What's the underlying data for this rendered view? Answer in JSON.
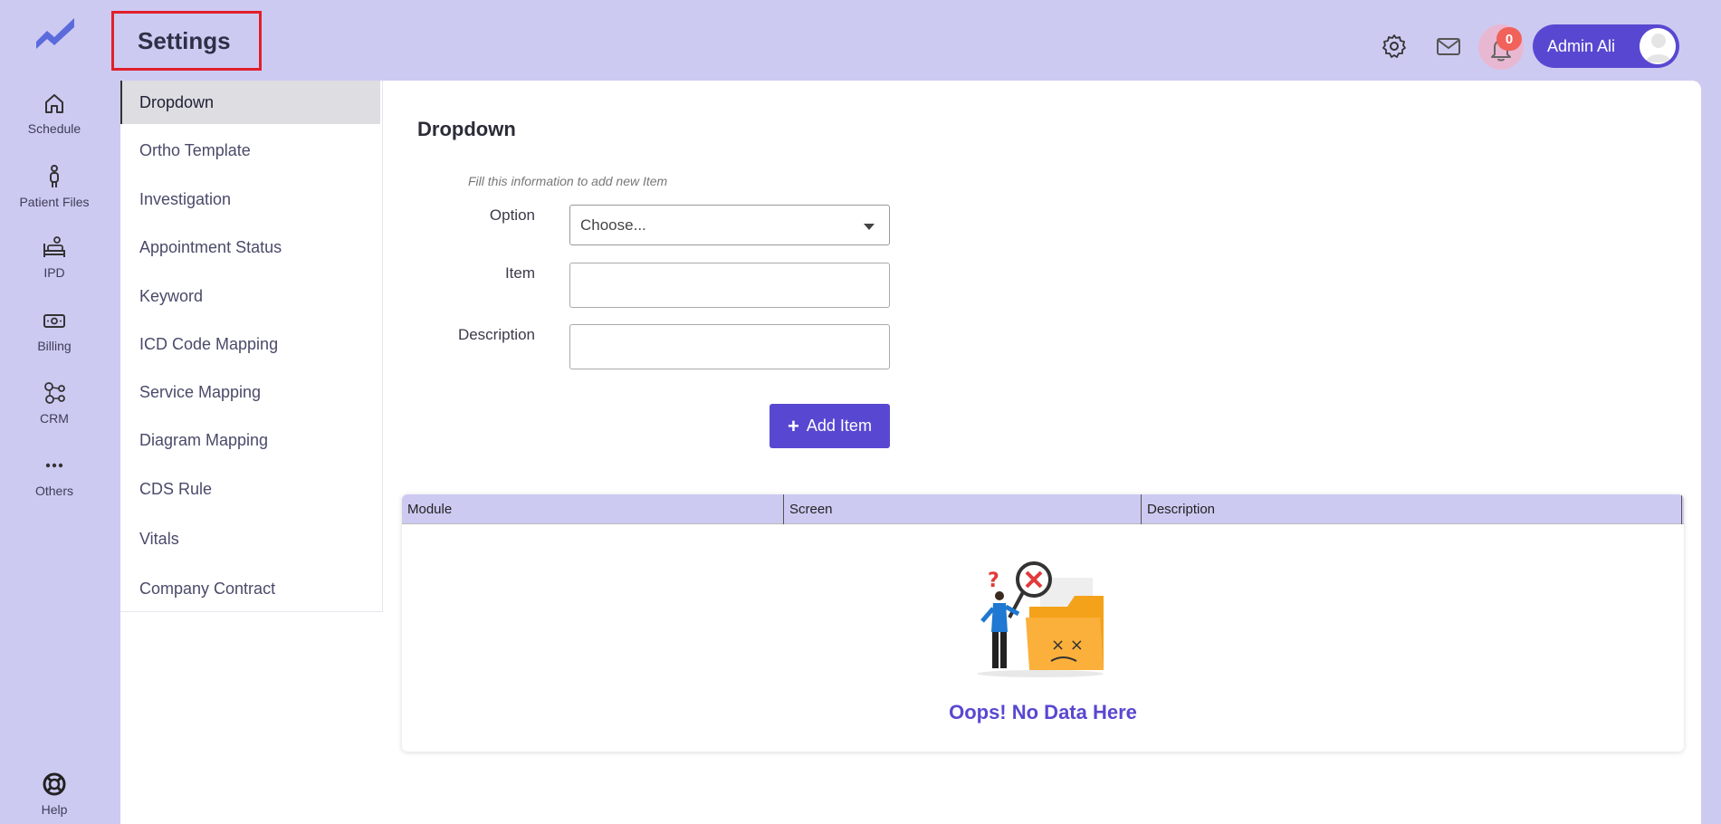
{
  "app": {
    "page_title": "Settings",
    "accent_color": "#5848d1",
    "sidebar_bg": "#cdcaf2"
  },
  "rail": {
    "items": [
      {
        "label": "Schedule",
        "icon": "home-icon"
      },
      {
        "label": "Patient Files",
        "icon": "person-icon"
      },
      {
        "label": "IPD",
        "icon": "bed-icon"
      },
      {
        "label": "Billing",
        "icon": "money-icon"
      },
      {
        "label": "CRM",
        "icon": "network-icon"
      },
      {
        "label": "Others",
        "icon": "more-icon"
      }
    ],
    "help_label": "Help"
  },
  "header": {
    "notification_count": "0",
    "user_name": "Admin Ali"
  },
  "submenu": {
    "items": [
      {
        "label": "Dropdown",
        "active": true
      },
      {
        "label": "Ortho Template"
      },
      {
        "label": "Investigation"
      },
      {
        "label": "Appointment Status"
      },
      {
        "label": "Keyword"
      },
      {
        "label": "ICD Code Mapping"
      },
      {
        "label": "Service Mapping"
      },
      {
        "label": "Diagram Mapping"
      },
      {
        "label": "CDS Rule"
      },
      {
        "label": "Vitals"
      },
      {
        "label": "Company Contract"
      }
    ]
  },
  "form": {
    "title": "Dropdown",
    "hint": "Fill this information to add new Item",
    "option_label": "Option",
    "option_value": "Choose...",
    "item_label": "Item",
    "item_value": "",
    "description_label": "Description",
    "description_value": "",
    "add_button_label": "Add Item"
  },
  "table": {
    "columns": [
      "Module",
      "Screen",
      "Description"
    ],
    "rows": [],
    "empty_message": "Oops! No Data Here"
  }
}
